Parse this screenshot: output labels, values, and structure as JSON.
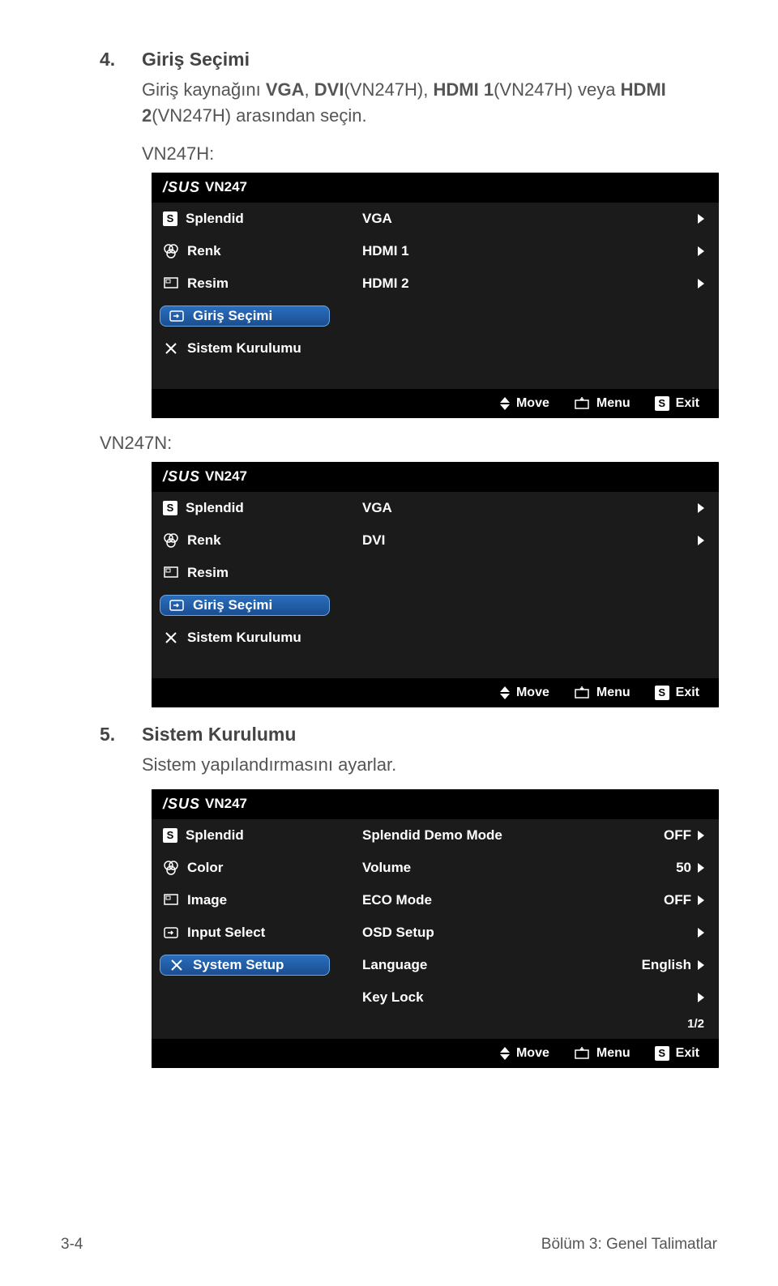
{
  "sections": {
    "s1": {
      "num": "4.",
      "title": "Giriş Seçimi",
      "desc_part1": "Giriş kaynağını ",
      "vga": "VGA",
      "comma": ", ",
      "dvi": "DVI",
      "model_a": "(VN247H)",
      "hdmi1": "HDMI 1",
      "veya": " veya ",
      "hdmi": "HDMI",
      "line2a": "2",
      "model_b": "(VN247H)",
      "line2b": " arasından seçin."
    },
    "s2": {
      "num": "5.",
      "title": "Sistem Kurulumu",
      "desc": "Sistem yapılandırmasını ayarlar."
    }
  },
  "labels": {
    "model1": "VN247H:",
    "model2": "VN247N:"
  },
  "osd_common": {
    "brand": "/SUS",
    "model": "VN247",
    "move": "Move",
    "menu": "Menu",
    "exit": "Exit",
    "s_key": "S"
  },
  "osd1": {
    "menu": {
      "splendid": "Splendid",
      "renk": "Renk",
      "resim": "Resim",
      "giris": "Giriş Seçimi",
      "sistem": "Sistem Kurulumu"
    },
    "opts": {
      "vga": "VGA",
      "hdmi1": "HDMI 1",
      "hdmi2": "HDMI 2"
    }
  },
  "osd2": {
    "menu": {
      "splendid": "Splendid",
      "renk": "Renk",
      "resim": "Resim",
      "giris": "Giriş Seçimi",
      "sistem": "Sistem Kurulumu"
    },
    "opts": {
      "vga": "VGA",
      "dvi": "DVI"
    }
  },
  "osd3": {
    "menu": {
      "splendid": "Splendid",
      "color": "Color",
      "image": "Image",
      "input": "Input Select",
      "system": "System Setup"
    },
    "opts": {
      "demo": "Splendid Demo Mode",
      "demo_v": "OFF",
      "vol": "Volume",
      "vol_v": "50",
      "eco": "ECO Mode",
      "eco_v": "OFF",
      "osd": "OSD Setup",
      "lang": "Language",
      "lang_v": "English",
      "keylock": "Key Lock",
      "page": "1/2"
    }
  },
  "footer": {
    "page": "3-4",
    "chapter": "Bölüm 3: Genel Talimatlar"
  }
}
